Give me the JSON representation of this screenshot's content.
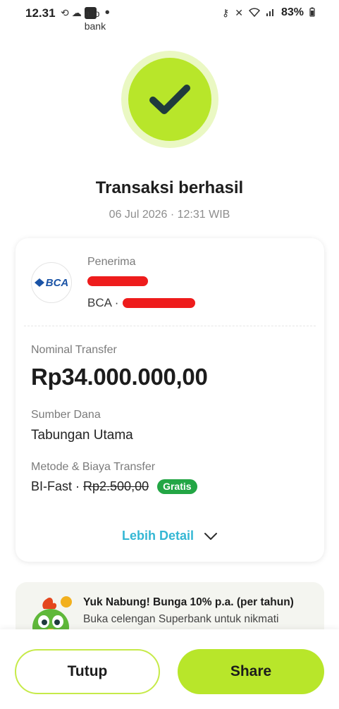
{
  "status_bar": {
    "time": "12.31",
    "app_badge": "allo bank",
    "battery": "83%",
    "icons": [
      "sync-icon",
      "cloud-icon",
      "app-badge-icon",
      "key-icon",
      "mute-icon",
      "wifi-icon",
      "signal-icon",
      "battery-icon"
    ]
  },
  "header": {
    "title": "Transaksi berhasil",
    "datetime": "06 Jul 2026 · 12:31 WIB",
    "status_icon": "checkmark-icon"
  },
  "recipient": {
    "label": "Penerima",
    "bank_logo_text": "BCA",
    "account_prefix": "BCA ·"
  },
  "transfer": {
    "amount_label": "Nominal Transfer",
    "amount": "Rp34.000.000,00",
    "source_label": "Sumber Dana",
    "source": "Tabungan Utama",
    "method_label": "Metode & Biaya Transfer",
    "method": "BI-Fast ·",
    "original_fee": "Rp2.500,00",
    "fee_badge": "Gratis"
  },
  "more_detail_label": "Lebih Detail",
  "promo": {
    "title": "Yuk Nabung! Bunga 10% p.a. (per tahun)",
    "description": "Buka celengan Superbank untuk nikmati"
  },
  "actions": {
    "close_label": "Tutup",
    "share_label": "Share"
  },
  "colors": {
    "accent": "#b8e62a",
    "accent_light": "#eaf8c3",
    "link": "#34b7d4",
    "badge_green": "#23a645",
    "redaction": "#ee1c1c"
  }
}
